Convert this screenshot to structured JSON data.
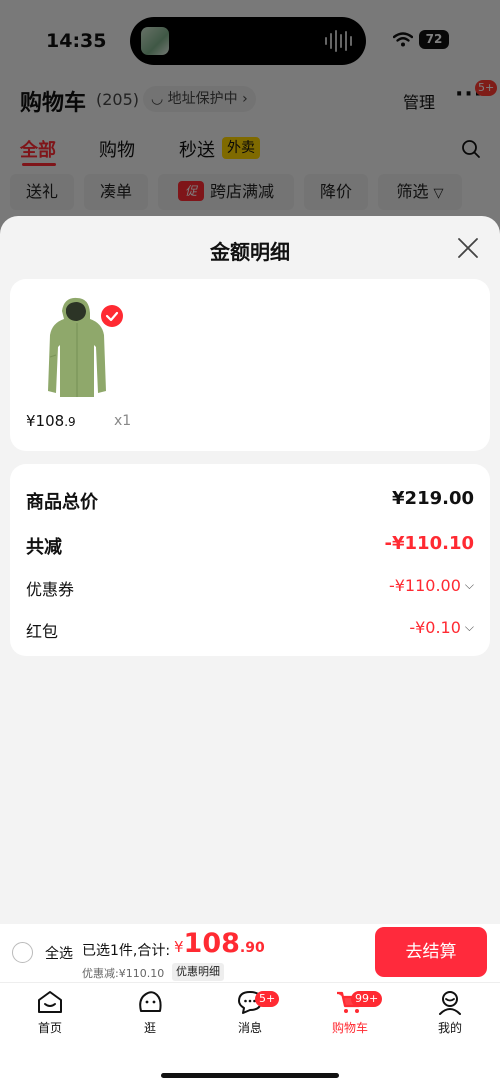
{
  "status_bar": {
    "time": "14:35",
    "battery": "72"
  },
  "header": {
    "title": "购物车",
    "count": "(205)",
    "address_protection": "地址保护中",
    "manage": "管理",
    "more_badge": "5+"
  },
  "tabs": [
    {
      "label": "全部"
    },
    {
      "label": "购物"
    },
    {
      "label": "秒送"
    }
  ],
  "takeout_tag": "外卖",
  "filters": [
    {
      "label": "送礼"
    },
    {
      "label": "凑单"
    },
    {
      "label": "跨店满减",
      "promo": "促"
    },
    {
      "label": "降价"
    },
    {
      "label": "筛选"
    }
  ],
  "sheet": {
    "title": "金额明细",
    "product": {
      "price_int": "¥108",
      "price_dec": ".9",
      "qty": "x1"
    },
    "rows": [
      {
        "label": "商品总价",
        "value": "¥219.00"
      },
      {
        "label": "共减",
        "value": "-¥110.10"
      },
      {
        "label": "优惠券",
        "value": "-¥110.00"
      },
      {
        "label": "红包",
        "value": "-¥0.10"
      }
    ]
  },
  "bottom_bar": {
    "select_all": "全选",
    "summary": "已选1件,合计:",
    "total_yen": "¥",
    "total_int": "108",
    "total_dec": ".90",
    "discount": "优惠减:¥110.10",
    "detail": "优惠明细",
    "checkout": "去结算"
  },
  "tabbar": [
    {
      "label": "首页"
    },
    {
      "label": "逛"
    },
    {
      "label": "消息",
      "badge": "5+"
    },
    {
      "label": "购物车",
      "badge": "99+"
    },
    {
      "label": "我的"
    }
  ],
  "colors": {
    "accent": "#ff2a32",
    "takeout": "#ffd400",
    "product": "#8fa86b"
  }
}
